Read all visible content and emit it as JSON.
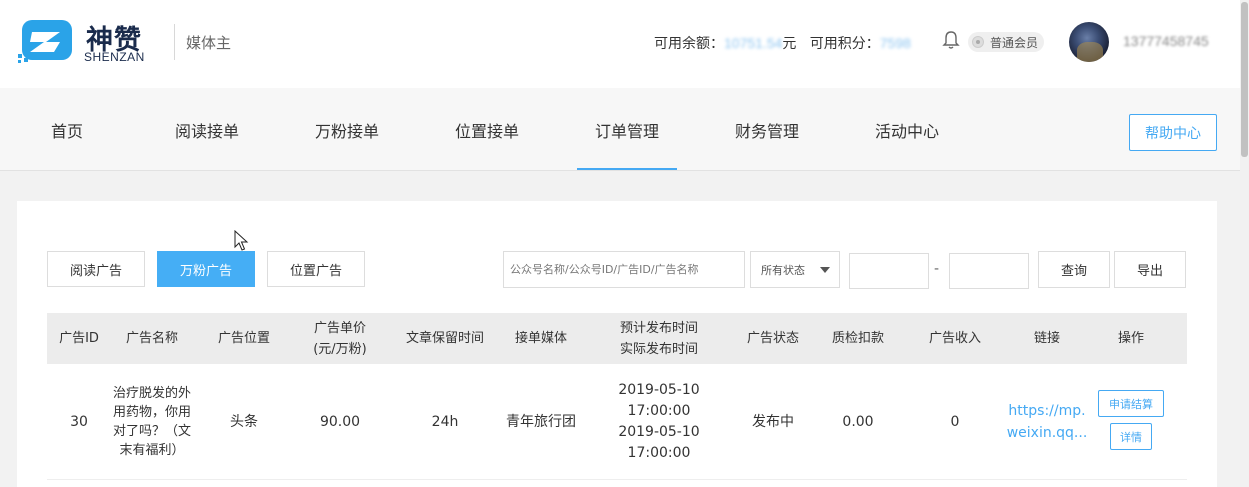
{
  "header": {
    "logo_cn": "神赞",
    "logo_en": "SHENZAN",
    "role": "媒体主",
    "balance_label": "可用余额：",
    "balance_value": "10751.54",
    "balance_unit": "元",
    "points_label": "可用积分：",
    "points_value": "7598",
    "member_level": "普通会员",
    "phone": "13777458745"
  },
  "nav": {
    "items": [
      "首页",
      "阅读接单",
      "万粉接单",
      "位置接单",
      "订单管理",
      "财务管理",
      "活动中心"
    ],
    "active": "订单管理",
    "help": "帮助中心"
  },
  "filters": {
    "tabs": [
      "阅读广告",
      "万粉广告",
      "位置广告"
    ],
    "active_tab": "万粉广告",
    "search_placeholder": "公众号名称/公众号ID/广告ID/广告名称",
    "status": "所有状态",
    "date_separator": "-",
    "query": "查询",
    "export": "导出"
  },
  "table": {
    "headers": [
      "广告ID",
      "广告名称",
      "广告位置",
      "广告单价\n(元/万粉)",
      "文章保留时间",
      "接单媒体",
      "预计发布时间\n实际发布时间",
      "广告状态",
      "质检扣款",
      "广告收入",
      "链接",
      "操作"
    ],
    "rows": [
      {
        "id": "30",
        "name": "治疗脱发的外\n用药物，你用\n对了吗？（文\n末有福利）",
        "position": "头条",
        "price": "90.00",
        "retention": "24h",
        "media": "青年旅行团",
        "times": "2019-05-10 17:00:00\n2019-05-10 17:00:00",
        "status": "发布中",
        "deduction": "0.00",
        "income": "0",
        "link": "https://mp.\nweixin.qq...",
        "action_settle": "申请结算",
        "action_detail": "详情"
      }
    ]
  },
  "colors": {
    "accent": "#45a9f3",
    "brand_dark": "#1a2b4c"
  }
}
